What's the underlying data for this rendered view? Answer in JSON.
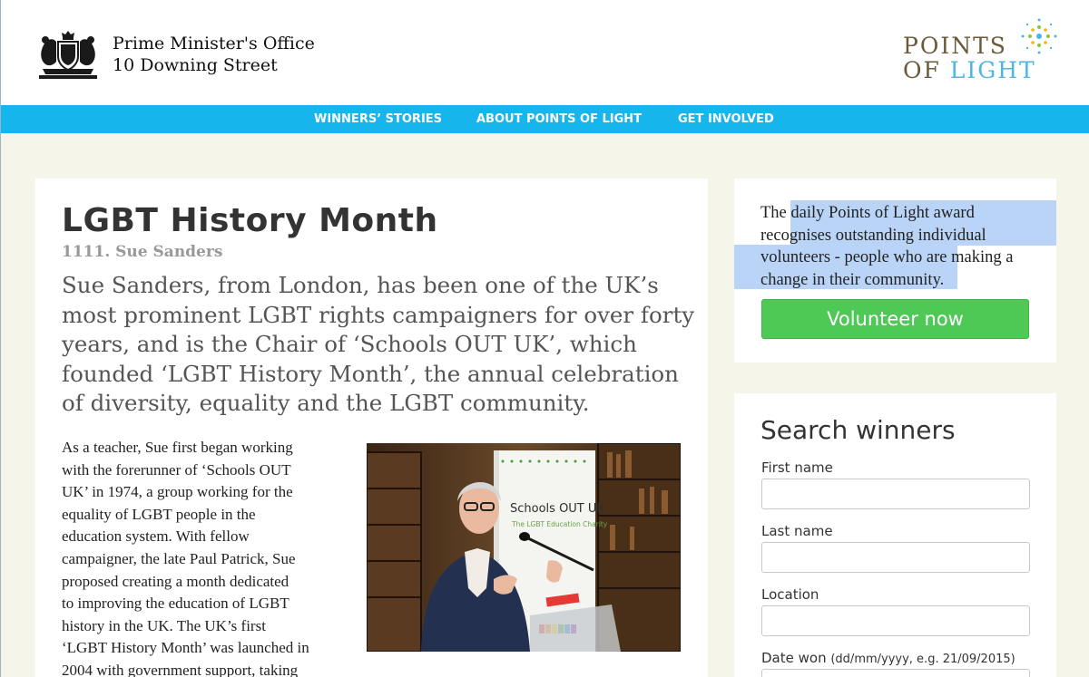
{
  "header": {
    "office_line1": "Prime Minister's Office",
    "office_line2": "10 Downing Street",
    "logo": {
      "line1": "POINTS",
      "of": "OF",
      "light": "LIGHT"
    },
    "crest_icon": "royal-coat-of-arms",
    "stars_icon": "points-of-light-star-burst"
  },
  "nav": {
    "items": [
      "WINNERS’ STORIES",
      "ABOUT POINTS OF LIGHT",
      "GET INVOLVED"
    ]
  },
  "article": {
    "title": "LGBT History Month",
    "subtitle": "1111. Sue Sanders",
    "intro": "Sue Sanders, from London, has been one of the UK’s most prominent LGBT rights campaigners for over forty years, and is the Chair of ‘Schools OUT UK’, which founded ‘LGBT History Month’, the annual celebration of diversity, equality and the LGBT community.",
    "body_lines": [
      "As a teacher, Sue first began working",
      "with the forerunner of ‘Schools OUT",
      "UK’ in 1974, a group working for the",
      "equality of LGBT people in the",
      "education system. With fellow",
      "campaigner, the late Paul Patrick, Sue",
      "proposed creating a month dedicated",
      "to improving the education of LGBT",
      "history in the UK. The UK’s first",
      "‘LGBT History Month’ was launched in",
      "2004 with government support, taking"
    ],
    "photo": {
      "banner_title": "Schools OUT UK",
      "banner_sub": "The LGBT Education Charity"
    }
  },
  "sidebar": {
    "award_lines": [
      "The daily Points of Light award",
      "recognises outstanding individual",
      "volunteers - people who are making a",
      "change in their community."
    ],
    "volunteer_label": "Volunteer now",
    "search": {
      "title": "Search winners",
      "first_name_label": "First name",
      "last_name_label": "Last name",
      "location_label": "Location",
      "date_label": "Date won",
      "date_hint": "(dd/mm/yyyy, e.g. 21/09/2015)"
    }
  },
  "colors": {
    "nav_bg": "#16b6ec",
    "page_bg": "#f5f5ea",
    "button_green": "#4ec956",
    "selection_highlight": "#b9d4f7",
    "logo_brown": "#6b5a3a",
    "logo_blue": "#4fb4e6"
  }
}
